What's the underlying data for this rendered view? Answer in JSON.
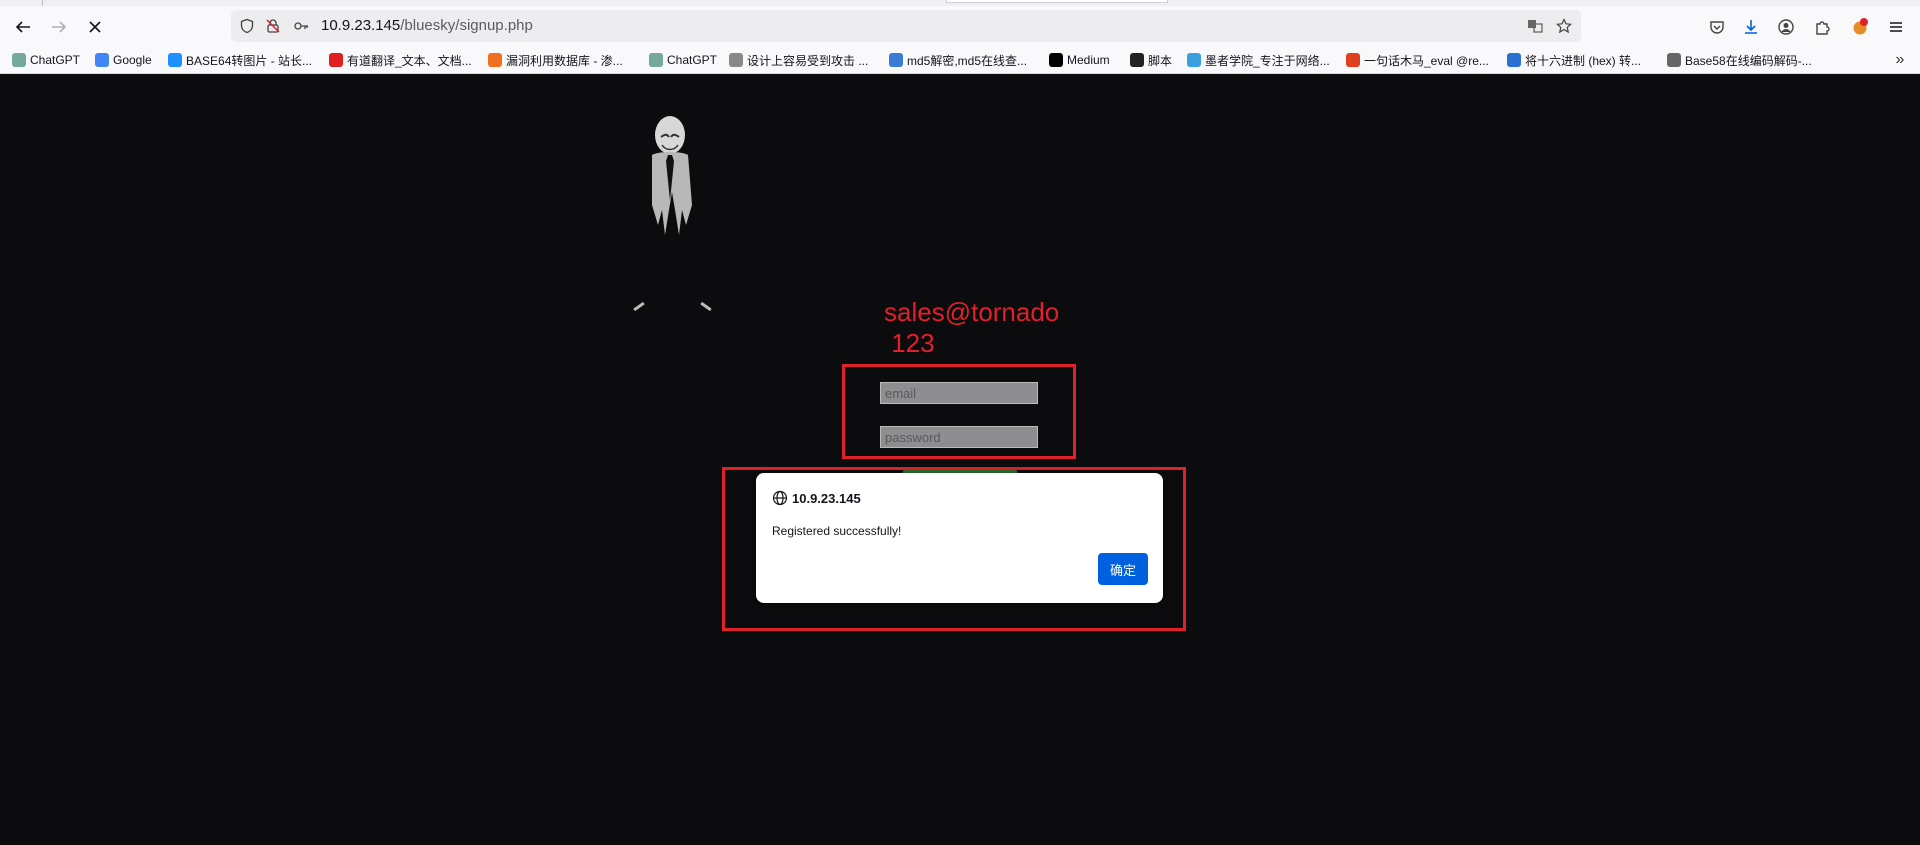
{
  "browser": {
    "url_host": "10.9.23.145",
    "url_path": "/bluesky/signup.php",
    "bookmarks": [
      {
        "label": "ChatGPT",
        "color": "#74aa9c"
      },
      {
        "label": "Google",
        "color": "#4285f4"
      },
      {
        "label": "BASE64转图片 - 站长...",
        "color": "#1e90ff"
      },
      {
        "label": "有道翻译_文本、文档...",
        "color": "#e02020"
      },
      {
        "label": "漏洞利用数据库 - 渗...",
        "color": "#f07020"
      },
      {
        "label": "ChatGPT",
        "color": "#74aa9c"
      },
      {
        "label": "设计上容易受到攻击 ...",
        "color": "#888888"
      },
      {
        "label": "md5解密,md5在线查...",
        "color": "#3a7bd5"
      },
      {
        "label": "Medium",
        "color": "#000000"
      },
      {
        "label": "脚本",
        "color": "#222222"
      },
      {
        "label": "墨者学院_专注于网络...",
        "color": "#3aa0e0"
      },
      {
        "label": "一句话木马_eval @re...",
        "color": "#e04020"
      },
      {
        "label": "将十六进制 (hex) 转...",
        "color": "#2a70d0"
      },
      {
        "label": "Base58在线编码解码-...",
        "color": "#666666"
      }
    ]
  },
  "annotation": {
    "text": "sales@tornado\n 123",
    "color": "#e0202a"
  },
  "form": {
    "email_placeholder": "email",
    "password_placeholder": "password"
  },
  "dialog": {
    "origin": "10.9.23.145",
    "message": "Registered successfully!",
    "ok_label": "确定"
  }
}
